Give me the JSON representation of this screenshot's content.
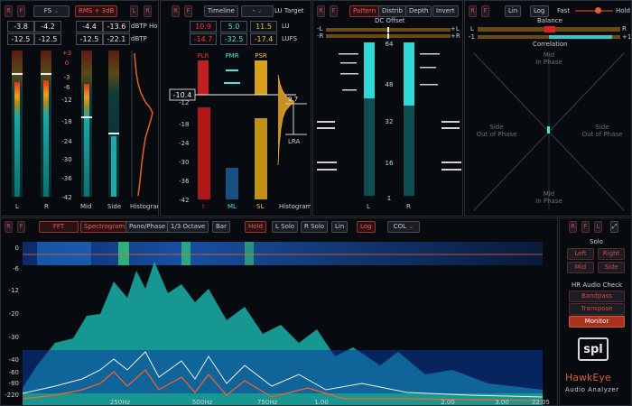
{
  "panel1": {
    "btn_r": "R",
    "btn_f": "F",
    "btn_fs": "FS",
    "btn_fs_arrow": "⌄",
    "btn_rms": "RMS + 3dB",
    "btn_l": "L",
    "btn_r2": "R",
    "v1": "-3.8",
    "v2": "-4.2",
    "v3": "-4.4",
    "v4": "-13.6",
    "dbtp_hold": "dBTP Hold",
    "v5": "-12.5",
    "v6": "-12.5",
    "v7": "-12.5",
    "v8": "-22.1",
    "dbtp": "dBTP",
    "scale": [
      "+3",
      "0",
      "-3",
      "-6",
      "-12",
      "-18",
      "-24",
      "-30",
      "-36",
      "-42"
    ],
    "lab_l": "L",
    "lab_r": "R",
    "lab_mid": "Mid",
    "lab_side": "Side",
    "lab_hist": "Histogram"
  },
  "panel2": {
    "btn_r": "R",
    "btn_f": "F",
    "btn_timeline": "Timeline",
    "btn_target": "-",
    "btn_target_arrow": "⌄",
    "target_label": "LU Target",
    "lu_r": "10.9",
    "lu_c": "5.0",
    "lu_y": "11.5",
    "lu_unit": "LU",
    "lufs_r": "-14.7",
    "lufs_c": "-32.5",
    "lufs_y": "-17.4",
    "lufs_unit": "LUFS",
    "plr": "PLR",
    "pmr": "PMR",
    "psr": "PSR",
    "marker": "-10.4",
    "lra_val": "9.7",
    "lra": "LRA",
    "scale": [
      "-12",
      "-18",
      "-24",
      "-30",
      "-36",
      "-42"
    ],
    "lab_i": "I",
    "lab_ml": "ML",
    "lab_sl": "SL",
    "lab_hist": "Histogram"
  },
  "panel3": {
    "btn_r": "R",
    "btn_f": "F",
    "btn_pattern": "Pattern",
    "btn_distrib": "Distrib",
    "btn_depth": "Depth",
    "btn_invert": "Invert",
    "dc_title": "DC Offset",
    "dc_l": "-L",
    "dc_r": "-R",
    "dc_pl": "+L",
    "dc_pr": "+R",
    "scale": [
      "64",
      "48",
      "32",
      "16",
      "1"
    ],
    "lab_l": "L",
    "lab_r": "R"
  },
  "panel4": {
    "btn_r": "R",
    "btn_f": "F",
    "btn_lin": "Lin",
    "btn_log": "Log",
    "fast": "Fast",
    "hold": "Hold",
    "balance": "Balance",
    "bal_l": "L",
    "bal_r": "R",
    "correlation": "Correlation",
    "corr_m": "-1",
    "corr_p": "+1",
    "top1": "Mid",
    "top2": "In Phase",
    "bot1": "Mid",
    "bot2": "In Phase",
    "left1": "Side",
    "left2": "Out of Phase",
    "right1": "Side",
    "right2": "Out of Phase"
  },
  "panel5": {
    "btn_r": "R",
    "btn_f": "F",
    "btn_fft": "FFT",
    "btn_spectrogram": "Spectrogram",
    "btn_pano": "Pano/Phase",
    "btn_oct": "1/3 Octave",
    "btn_bar": "Bar",
    "btn_hold": "Hold",
    "btn_lsolo": "L Solo",
    "btn_rsolo": "R Solo",
    "btn_lin": "Lin",
    "btn_log": "Log",
    "btn_col": "COL",
    "btn_col_arrow": "⌄",
    "y_labels": [
      "0",
      "-6",
      "-12",
      "-20",
      "-30",
      "-40",
      "-60",
      "-80",
      "-220"
    ],
    "x_labels": [
      "250Hz",
      "500Hz",
      "750Hz",
      "1.00",
      "2.00",
      "3.00",
      "22.05"
    ]
  },
  "side": {
    "btn_r": "R",
    "btn_f": "F",
    "btn_l": "L",
    "btn_expand": "⤢",
    "solo": "Solo",
    "left": "Left",
    "right": "Right",
    "mid": "Mid",
    "side": "Side",
    "hr": "HR Audio Check",
    "bandpass": "Bandpass",
    "transpose": "Transpose",
    "monitor": "Monitor",
    "logo": "spl",
    "product": "HawkEye",
    "subtitle": "Audio Analyzer"
  }
}
